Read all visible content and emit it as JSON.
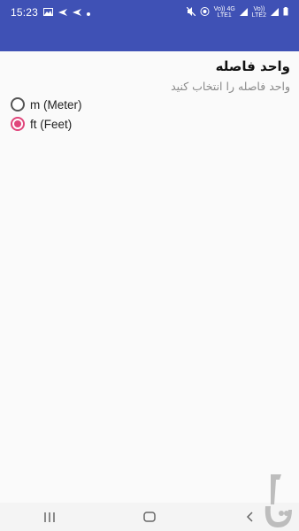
{
  "status_bar": {
    "time": "15:23",
    "lte_labels": [
      "Vo)) 4G",
      "LTE1",
      "Vo))",
      "LTE2"
    ]
  },
  "settings": {
    "title": "واحد فاصله",
    "subtitle": "واحد فاصله را انتخاب کنید",
    "options": [
      {
        "label": "m (Meter)",
        "selected": false
      },
      {
        "label": "ft (Feet)",
        "selected": true
      }
    ]
  },
  "colors": {
    "primary": "#3f51b5",
    "accent": "#e0457b",
    "background": "#fafafa"
  },
  "icons": [
    "gallery-icon",
    "send-icon",
    "mute-icon",
    "wifi-icon",
    "signal-icon",
    "battery-icon",
    "recents-icon",
    "home-icon",
    "back-icon"
  ]
}
